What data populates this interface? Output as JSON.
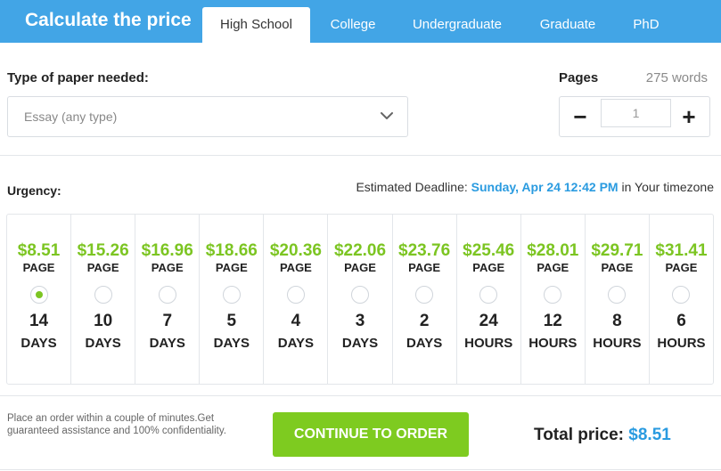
{
  "header": {
    "title": "Calculate the price",
    "tabs": [
      {
        "label": "High School",
        "active": true
      },
      {
        "label": "College",
        "active": false
      },
      {
        "label": "Undergraduate",
        "active": false
      },
      {
        "label": "Graduate",
        "active": false
      },
      {
        "label": "PhD",
        "active": false
      }
    ]
  },
  "paper": {
    "label": "Type of paper needed:",
    "selected": "Essay (any type)",
    "chevron_icon": "chevron-down-icon"
  },
  "pages": {
    "label": "Pages",
    "words": "275 words",
    "decrement": "−",
    "increment": "+",
    "value": "1"
  },
  "urgency": {
    "label": "Urgency:",
    "deadline_prefix": "Estimated Deadline:",
    "deadline_date": "Sunday, Apr 24 12:42 PM",
    "deadline_suffix": " in Your timezone",
    "per_label": "PAGE",
    "options": [
      {
        "price": "$8.51",
        "amount": "14",
        "unit": "DAYS",
        "selected": true
      },
      {
        "price": "$15.26",
        "amount": "10",
        "unit": "DAYS",
        "selected": false
      },
      {
        "price": "$16.96",
        "amount": "7",
        "unit": "DAYS",
        "selected": false
      },
      {
        "price": "$18.66",
        "amount": "5",
        "unit": "DAYS",
        "selected": false
      },
      {
        "price": "$20.36",
        "amount": "4",
        "unit": "DAYS",
        "selected": false
      },
      {
        "price": "$22.06",
        "amount": "3",
        "unit": "DAYS",
        "selected": false
      },
      {
        "price": "$23.76",
        "amount": "2",
        "unit": "DAYS",
        "selected": false
      },
      {
        "price": "$25.46",
        "amount": "24",
        "unit": "HOURS",
        "selected": false
      },
      {
        "price": "$28.01",
        "amount": "12",
        "unit": "HOURS",
        "selected": false
      },
      {
        "price": "$29.71",
        "amount": "8",
        "unit": "HOURS",
        "selected": false
      },
      {
        "price": "$31.41",
        "amount": "6",
        "unit": "HOURS",
        "selected": false
      }
    ]
  },
  "footer": {
    "note": "Place an order within a couple of minutes.Get guaranteed assistance and 100% confidentiality.",
    "cta": "CONTINUE TO ORDER",
    "total_label": "Total price:",
    "total_value": "$8.51"
  },
  "colors": {
    "header": "#42a5e6",
    "price_green": "#7cc522",
    "accent_blue": "#2a9be0",
    "cta_green": "#7ecb20"
  }
}
